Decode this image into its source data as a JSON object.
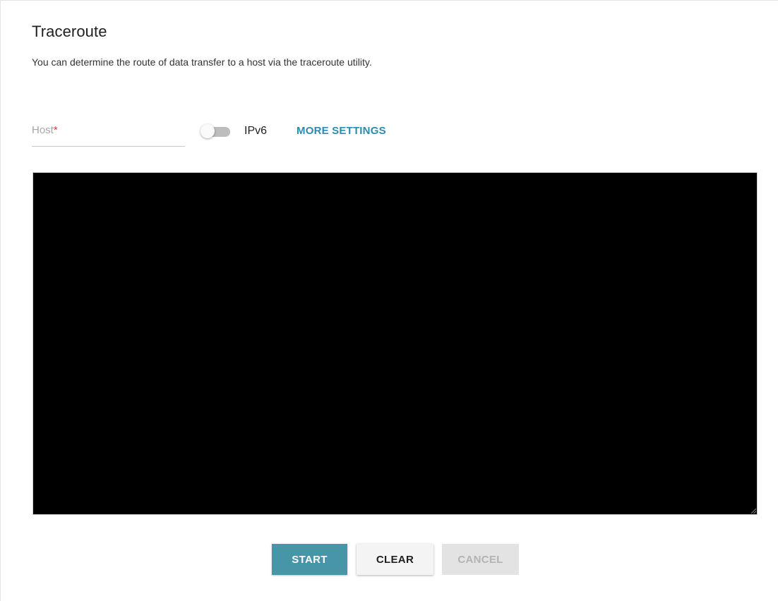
{
  "page": {
    "title": "Traceroute",
    "description": "You can determine the route of data transfer to a host via the traceroute utility."
  },
  "form": {
    "host": {
      "label": "Host",
      "required_marker": "*",
      "value": ""
    },
    "ipv6_toggle": {
      "label": "IPv6",
      "enabled": false
    },
    "more_settings_label": "MORE SETTINGS"
  },
  "console": {
    "output": ""
  },
  "buttons": {
    "start": "START",
    "clear": "CLEAR",
    "cancel": "CANCEL"
  },
  "colors": {
    "accent": "#2b8bb0",
    "start_button": "#4696a8",
    "console_background": "#000000",
    "required_marker": "#e53935",
    "disabled_text": "#b3b3b3"
  }
}
